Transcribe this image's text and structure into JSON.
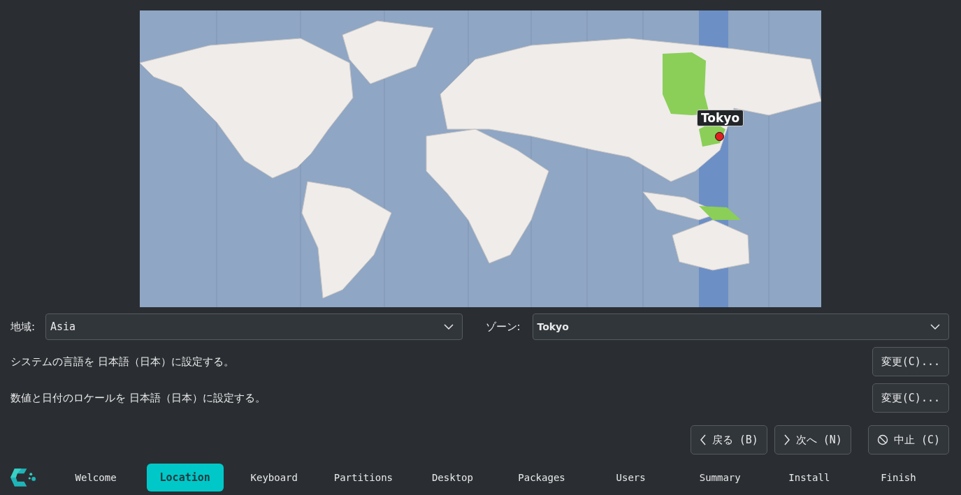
{
  "map": {
    "pin_label": "Tokyo"
  },
  "region": {
    "label": "地域:",
    "value": "Asia"
  },
  "zone": {
    "label": "ゾーン:",
    "value": "Tokyo"
  },
  "locale_rows": [
    {
      "text": "システムの言語を 日本語（日本）に設定する。",
      "button": "変更(C)..."
    },
    {
      "text": "数値と日付のロケールを 日本語（日本）に設定する。",
      "button": "変更(C)..."
    }
  ],
  "nav_buttons": [
    {
      "kind": "back",
      "label": "戻る (B)"
    },
    {
      "kind": "next",
      "label": "次へ (N)"
    },
    {
      "kind": "cancel",
      "label": "中止 (C)"
    }
  ],
  "steps": [
    {
      "label": "Welcome",
      "selected": false
    },
    {
      "label": "Location",
      "selected": true
    },
    {
      "label": "Keyboard",
      "selected": false
    },
    {
      "label": "Partitions",
      "selected": false
    },
    {
      "label": "Desktop",
      "selected": false
    },
    {
      "label": "Packages",
      "selected": false
    },
    {
      "label": "Users",
      "selected": false
    },
    {
      "label": "Summary",
      "selected": false
    },
    {
      "label": "Install",
      "selected": false
    },
    {
      "label": "Finish",
      "selected": false
    }
  ]
}
